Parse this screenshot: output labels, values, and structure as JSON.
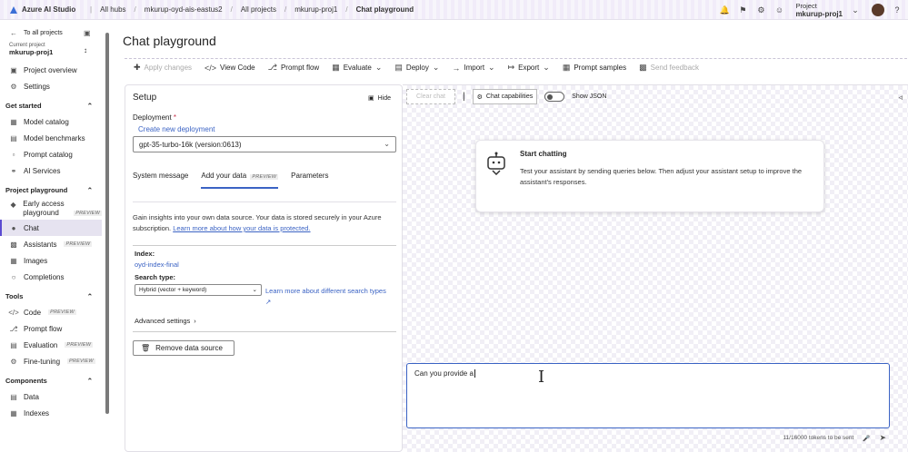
{
  "app": {
    "name": "Azure AI Studio"
  },
  "breadcrumb": [
    "All hubs",
    "mkurup-oyd-ais-eastus2",
    "All projects",
    "mkurup-proj1",
    "Chat playground"
  ],
  "header_right": {
    "project_label": "Project",
    "project_name": "mkurup-proj1"
  },
  "sidebar": {
    "back": "To all projects",
    "current_project_label": "Current project",
    "current_project": "mkurup-proj1",
    "top_items": [
      "Project overview",
      "Settings"
    ],
    "sections": [
      {
        "title": "Get started",
        "items": [
          {
            "label": "Model catalog"
          },
          {
            "label": "Model benchmarks"
          },
          {
            "label": "Prompt catalog"
          },
          {
            "label": "AI Services"
          }
        ]
      },
      {
        "title": "Project playground",
        "items": [
          {
            "label": "Early access playground",
            "badge": "PREVIEW"
          },
          {
            "label": "Chat"
          },
          {
            "label": "Assistants",
            "badge": "PREVIEW"
          },
          {
            "label": "Images"
          },
          {
            "label": "Completions"
          }
        ]
      },
      {
        "title": "Tools",
        "items": [
          {
            "label": "Code",
            "badge": "PREVIEW"
          },
          {
            "label": "Prompt flow"
          },
          {
            "label": "Evaluation",
            "badge": "PREVIEW"
          },
          {
            "label": "Fine-tuning",
            "badge": "PREVIEW"
          }
        ]
      },
      {
        "title": "Components",
        "items": [
          {
            "label": "Data"
          },
          {
            "label": "Indexes"
          }
        ]
      }
    ]
  },
  "page": {
    "title": "Chat playground"
  },
  "toolbar": [
    "Apply changes",
    "View Code",
    "Prompt flow",
    "Evaluate",
    "Deploy",
    "Import",
    "Export",
    "Prompt samples",
    "Send feedback"
  ],
  "setup": {
    "title": "Setup",
    "hide": "Hide",
    "deployment_label": "Deployment",
    "create_link": "Create new deployment",
    "deployment_value": "gpt-35-turbo-16k (version:0613)",
    "tabs": [
      "System message",
      "Add your data",
      "Parameters"
    ],
    "tab_badge": "PREVIEW",
    "intro": "Gain insights into your own data source. Your data is stored securely in your Azure subscription.",
    "intro_link": "Learn more about how your data is protected.",
    "index_label": "Index:",
    "index_value": "oyd-index-final",
    "search_type_label": "Search type:",
    "search_type_value": "Hybrid (vector + keyword)",
    "search_link": "Learn more about different search types",
    "advanced": "Advanced settings",
    "remove": "Remove data source"
  },
  "chat": {
    "clear": "Clear chat",
    "capabilities": "Chat capabilities",
    "show_json": "Show JSON",
    "card_title": "Start chatting",
    "card_text": "Test your assistant by sending queries below. Then adjust your assistant setup to improve the assistant's responses.",
    "input_value": "Can you provide a",
    "tokens": "11/16000 tokens to be sent"
  }
}
